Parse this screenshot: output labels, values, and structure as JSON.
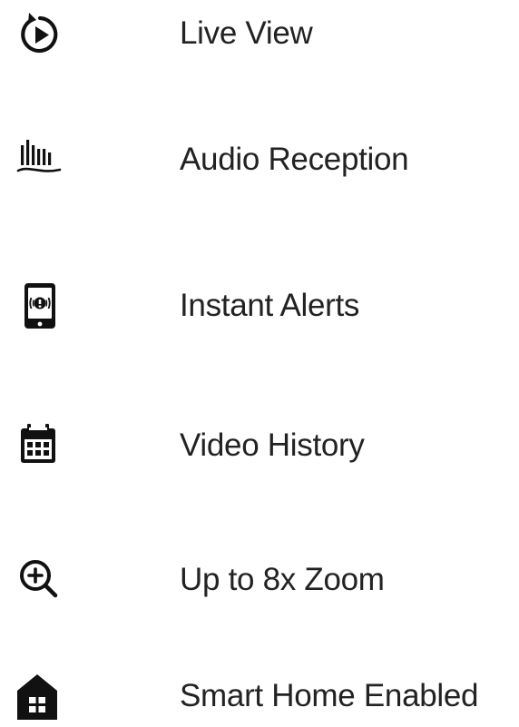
{
  "features": [
    {
      "label": "Live View",
      "icon": "replay-play-icon"
    },
    {
      "label": "Audio Reception",
      "icon": "audio-wave-icon"
    },
    {
      "label": "Instant Alerts",
      "icon": "phone-alert-icon"
    },
    {
      "label": "Video History",
      "icon": "calendar-icon"
    },
    {
      "label": "Up to 8x Zoom",
      "icon": "zoom-in-icon"
    },
    {
      "label": "Smart Home Enabled",
      "icon": "home-icon"
    }
  ],
  "colors": {
    "text": "#222222",
    "icon": "#111111",
    "background": "#ffffff"
  }
}
